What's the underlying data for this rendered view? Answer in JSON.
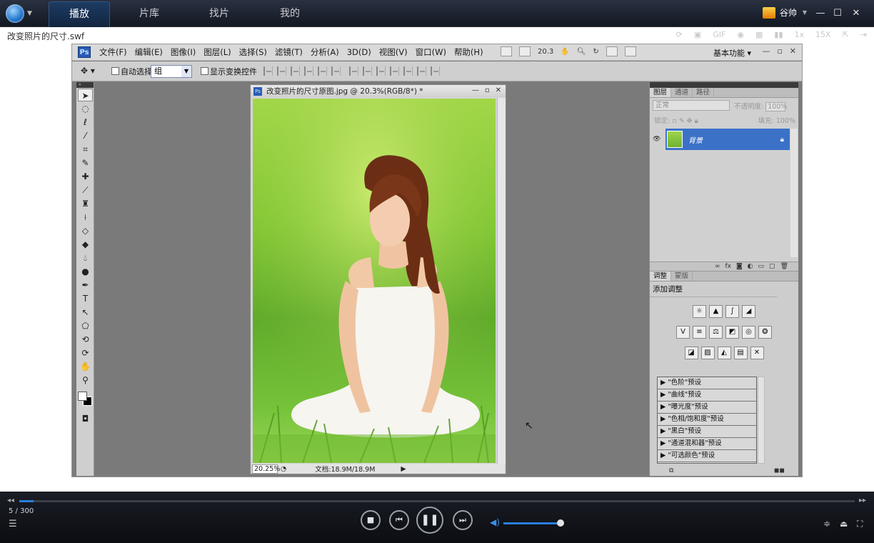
{
  "player": {
    "tabs": [
      "播放",
      "片库",
      "找片",
      "我的"
    ],
    "user_name": "谷帅",
    "file_title": "改变照片的尺寸.swf",
    "strip_tools": [
      "1x",
      "15X"
    ],
    "progress": {
      "current": 5,
      "total": 300,
      "label": "5 / 300",
      "fraction": 0.017
    },
    "volume_fraction": 0.85
  },
  "photoshop": {
    "menus": [
      "文件(F)",
      "编辑(E)",
      "图像(I)",
      "图层(L)",
      "选择(S)",
      "滤镜(T)",
      "分析(A)",
      "3D(D)",
      "视图(V)",
      "窗口(W)",
      "帮助(H)"
    ],
    "zoom_menu": "20.3",
    "workspace": "基本功能",
    "options": {
      "auto_select_label": "自动选择:",
      "auto_select_value": "组",
      "transform_label": "显示变换控件"
    },
    "document": {
      "title": "改变照片的尺寸原图.jpg @ 20.3%(RGB/8*) *",
      "zoom": "20.25%",
      "info": "文档:18.9M/18.9M"
    },
    "layers_panel": {
      "tabs": [
        "图层",
        "通道",
        "路径"
      ],
      "blend_mode": "正常",
      "opacity_label": "不透明度:",
      "opacity_value": "100%",
      "lock_label": "锁定:",
      "fill_label": "填充:",
      "fill_value": "100%",
      "layer_name": "背景"
    },
    "adjust_panel": {
      "tabs": [
        "调整",
        "蒙版"
      ],
      "title": "添加调整",
      "presets": [
        "\"色阶\"预设",
        "\"曲线\"预设",
        "\"曝光度\"预设",
        "\"色相/饱和度\"预设",
        "\"黑白\"预设",
        "\"通道混和器\"预设",
        "\"可选颜色\"预设"
      ]
    }
  }
}
